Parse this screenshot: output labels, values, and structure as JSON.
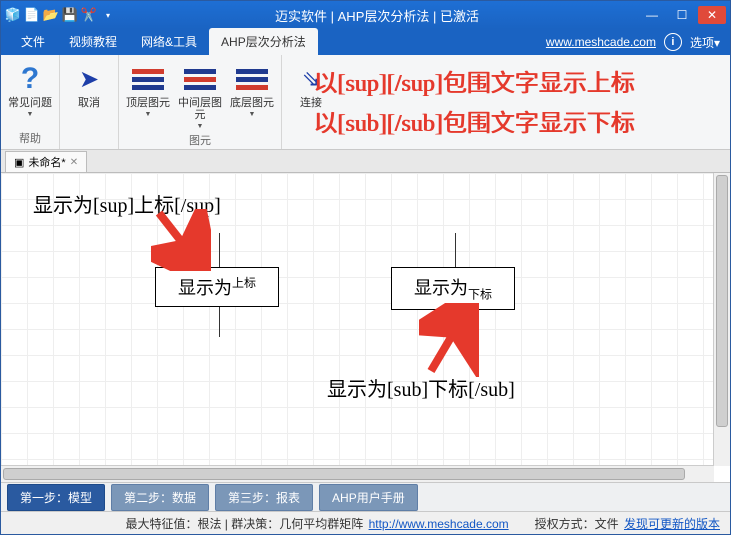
{
  "titlebar": {
    "title": "迈实软件 | AHP层次分析法 | 已激活"
  },
  "menu": {
    "tabs": [
      "文件",
      "视频教程",
      "网络&工具",
      "AHP层次分析法"
    ],
    "active": 3,
    "url": "www.meshcade.com",
    "options": "选项"
  },
  "ribbon": {
    "help_group": "帮助",
    "help_btn": "常见问题",
    "cancel_btn": "取消",
    "layer_group": "图元",
    "layer_top": "顶层图元",
    "layer_mid": "中间层图元",
    "layer_bot": "底层图元",
    "connect_btn": "连接"
  },
  "overlay": {
    "line1": "以[sup][/sup]包围文字显示上标",
    "line2": "以[sub][/sub]包围文字显示下标"
  },
  "doc": {
    "tab": "未命名*"
  },
  "canvas": {
    "caption_sup": "显示为[sup]上标[/sup]",
    "caption_sub": "显示为[sub]下标[/sub]",
    "node_sup_base": "显示为",
    "node_sup_sup": "上标",
    "node_sub_base": "显示为",
    "node_sub_sub": "下标"
  },
  "steps": {
    "s1": "第一步：模型",
    "s2": "第二步：数据",
    "s3": "第三步：报表",
    "s4": "AHP用户手册"
  },
  "status": {
    "left": "最大特征值：根法 | 群决策：几何平均群矩阵 ",
    "link": "http://www.meshcade.com",
    "auth": "授权方式：文件",
    "update": "发现可更新的版本"
  }
}
